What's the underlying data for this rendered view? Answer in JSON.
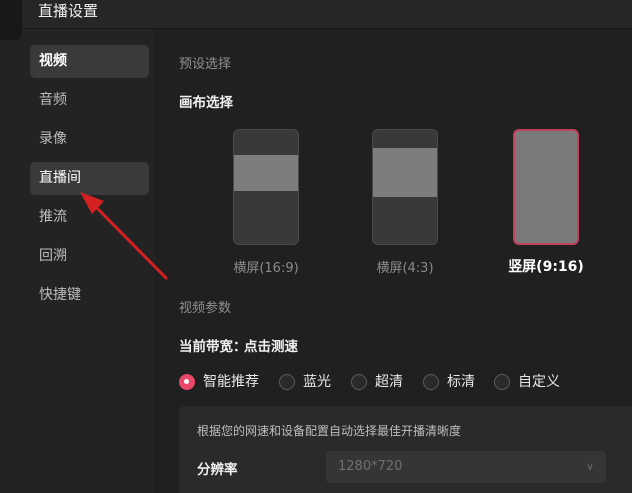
{
  "window": {
    "title": "直播设置"
  },
  "sidebar": {
    "items": [
      {
        "label": "视频"
      },
      {
        "label": "音频"
      },
      {
        "label": "录像"
      },
      {
        "label": "直播间"
      },
      {
        "label": "推流"
      },
      {
        "label": "回溯"
      },
      {
        "label": "快捷键"
      }
    ]
  },
  "preset": {
    "section_title": "预设选择",
    "canvas_title": "画布选择",
    "options": [
      {
        "label": "横屏(16:9)",
        "selected": false
      },
      {
        "label": "横屏(4:3)",
        "selected": false
      },
      {
        "label": "竖屏(9:16)",
        "selected": true
      }
    ]
  },
  "video": {
    "section_title": "视频参数",
    "bandwidth_label": "当前带宽：",
    "bandwidth_action": "点击测速",
    "quality_options": [
      {
        "label": "智能推荐",
        "checked": true
      },
      {
        "label": "蓝光",
        "checked": false
      },
      {
        "label": "超清",
        "checked": false
      },
      {
        "label": "标清",
        "checked": false
      },
      {
        "label": "自定义",
        "checked": false
      }
    ],
    "hint": "根据您的网速和设备配置自动选择最佳开播清晰度",
    "resolution_label": "分辨率",
    "resolution_value": "1280*720"
  },
  "colors": {
    "accent": "#e9486a",
    "annotation_arrow": "#d42020"
  }
}
